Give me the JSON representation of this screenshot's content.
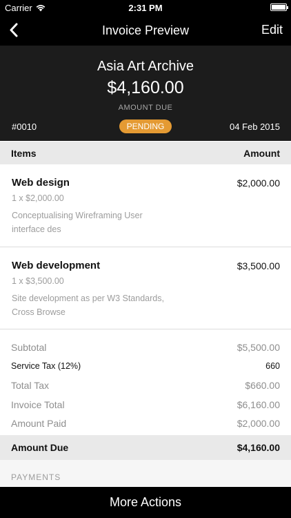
{
  "status_bar": {
    "carrier": "Carrier",
    "time": "2:31 PM"
  },
  "nav": {
    "title": "Invoice Preview",
    "edit_label": "Edit"
  },
  "invoice": {
    "client": "Asia Art Archive",
    "amount": "$4,160.00",
    "amount_label": "AMOUNT DUE",
    "number": "#0010",
    "status": "PENDING",
    "date": "04 Feb 2015"
  },
  "items_header": {
    "items_label": "Items",
    "amount_label": "Amount"
  },
  "items": [
    {
      "name": "Web design",
      "price": "$2,000.00",
      "qty": "1 x $2,000.00",
      "description": "Conceptualising  Wireframing  User interface des"
    },
    {
      "name": "Web development",
      "price": "$3,500.00",
      "qty": "1 x $3,500.00",
      "description": "Site development as per W3 Standards, Cross Browse"
    }
  ],
  "totals": {
    "subtotal_label": "Subtotal",
    "subtotal": "$5,500.00",
    "service_tax_label": "Service Tax (12%)",
    "service_tax": "660",
    "total_tax_label": "Total Tax",
    "total_tax": "$660.00",
    "invoice_total_label": "Invoice Total",
    "invoice_total": "$6,160.00",
    "amount_paid_label": "Amount Paid",
    "amount_paid": "$2,000.00"
  },
  "amount_due": {
    "label": "Amount Due",
    "value": "$4,160.00"
  },
  "payments": {
    "label": "PAYMENTS"
  },
  "bottom": {
    "more_actions_label": "More Actions"
  },
  "colors": {
    "status_pending": "#e49a33",
    "header_bg": "#1c1c1c",
    "bar_bg": "#000000"
  }
}
